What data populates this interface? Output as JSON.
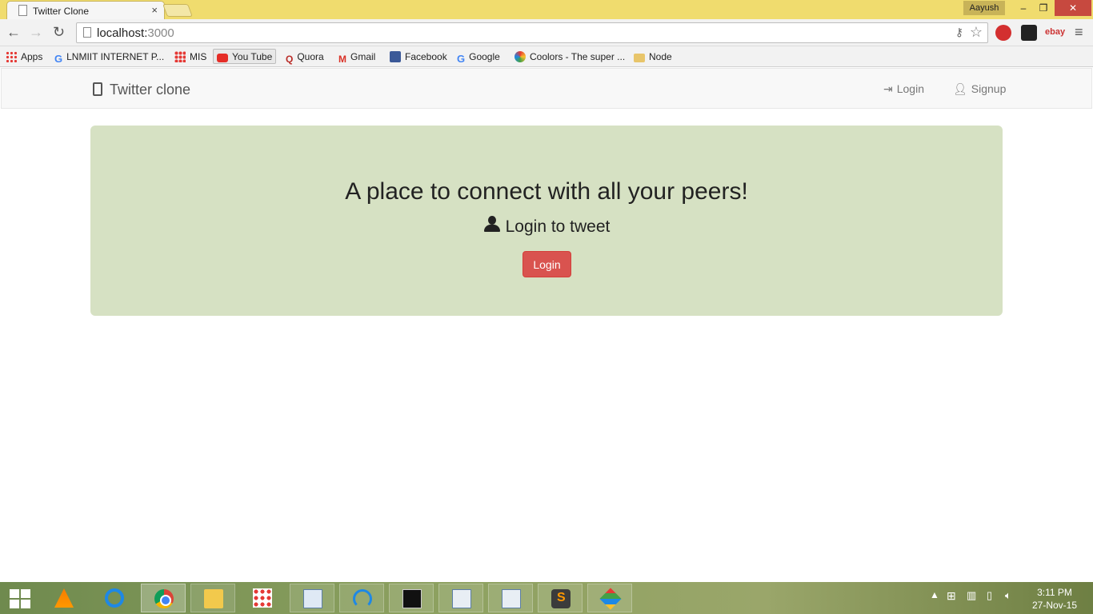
{
  "browser": {
    "tab_title": "Twitter Clone",
    "tab_close": "×",
    "profile_name": "Aayush",
    "url_host": "localhost:",
    "url_port": "3000",
    "ext_ebay": "ebay",
    "window_controls": {
      "minimize": "–",
      "restore": "❐",
      "close": "✕"
    }
  },
  "bookmarks": [
    {
      "label": "Apps",
      "icon": "apps-grid-icon"
    },
    {
      "label": "LNMIIT INTERNET P...",
      "icon": "google-icon"
    },
    {
      "label": "MIS",
      "icon": "mis-icon"
    },
    {
      "label": "You Tube",
      "icon": "youtube-icon"
    },
    {
      "label": "Quora",
      "icon": "quora-icon"
    },
    {
      "label": "Gmail",
      "icon": "gmail-icon"
    },
    {
      "label": "Facebook",
      "icon": "facebook-icon"
    },
    {
      "label": "Google",
      "icon": "google-icon"
    },
    {
      "label": "Coolors - The super ...",
      "icon": "coolors-icon"
    },
    {
      "label": "Node",
      "icon": "folder-icon"
    }
  ],
  "navbar": {
    "brand": "Twitter clone",
    "login": "Login",
    "signup": "Signup"
  },
  "hero": {
    "heading": "A place to connect with all your peers!",
    "subheading": "Login to tweet",
    "login_button": "Login",
    "accent_color": "#d9534f",
    "background_color": "#d6e1c3"
  },
  "taskbar": {
    "time": "3:11 PM",
    "date": "27-Nov-15"
  }
}
